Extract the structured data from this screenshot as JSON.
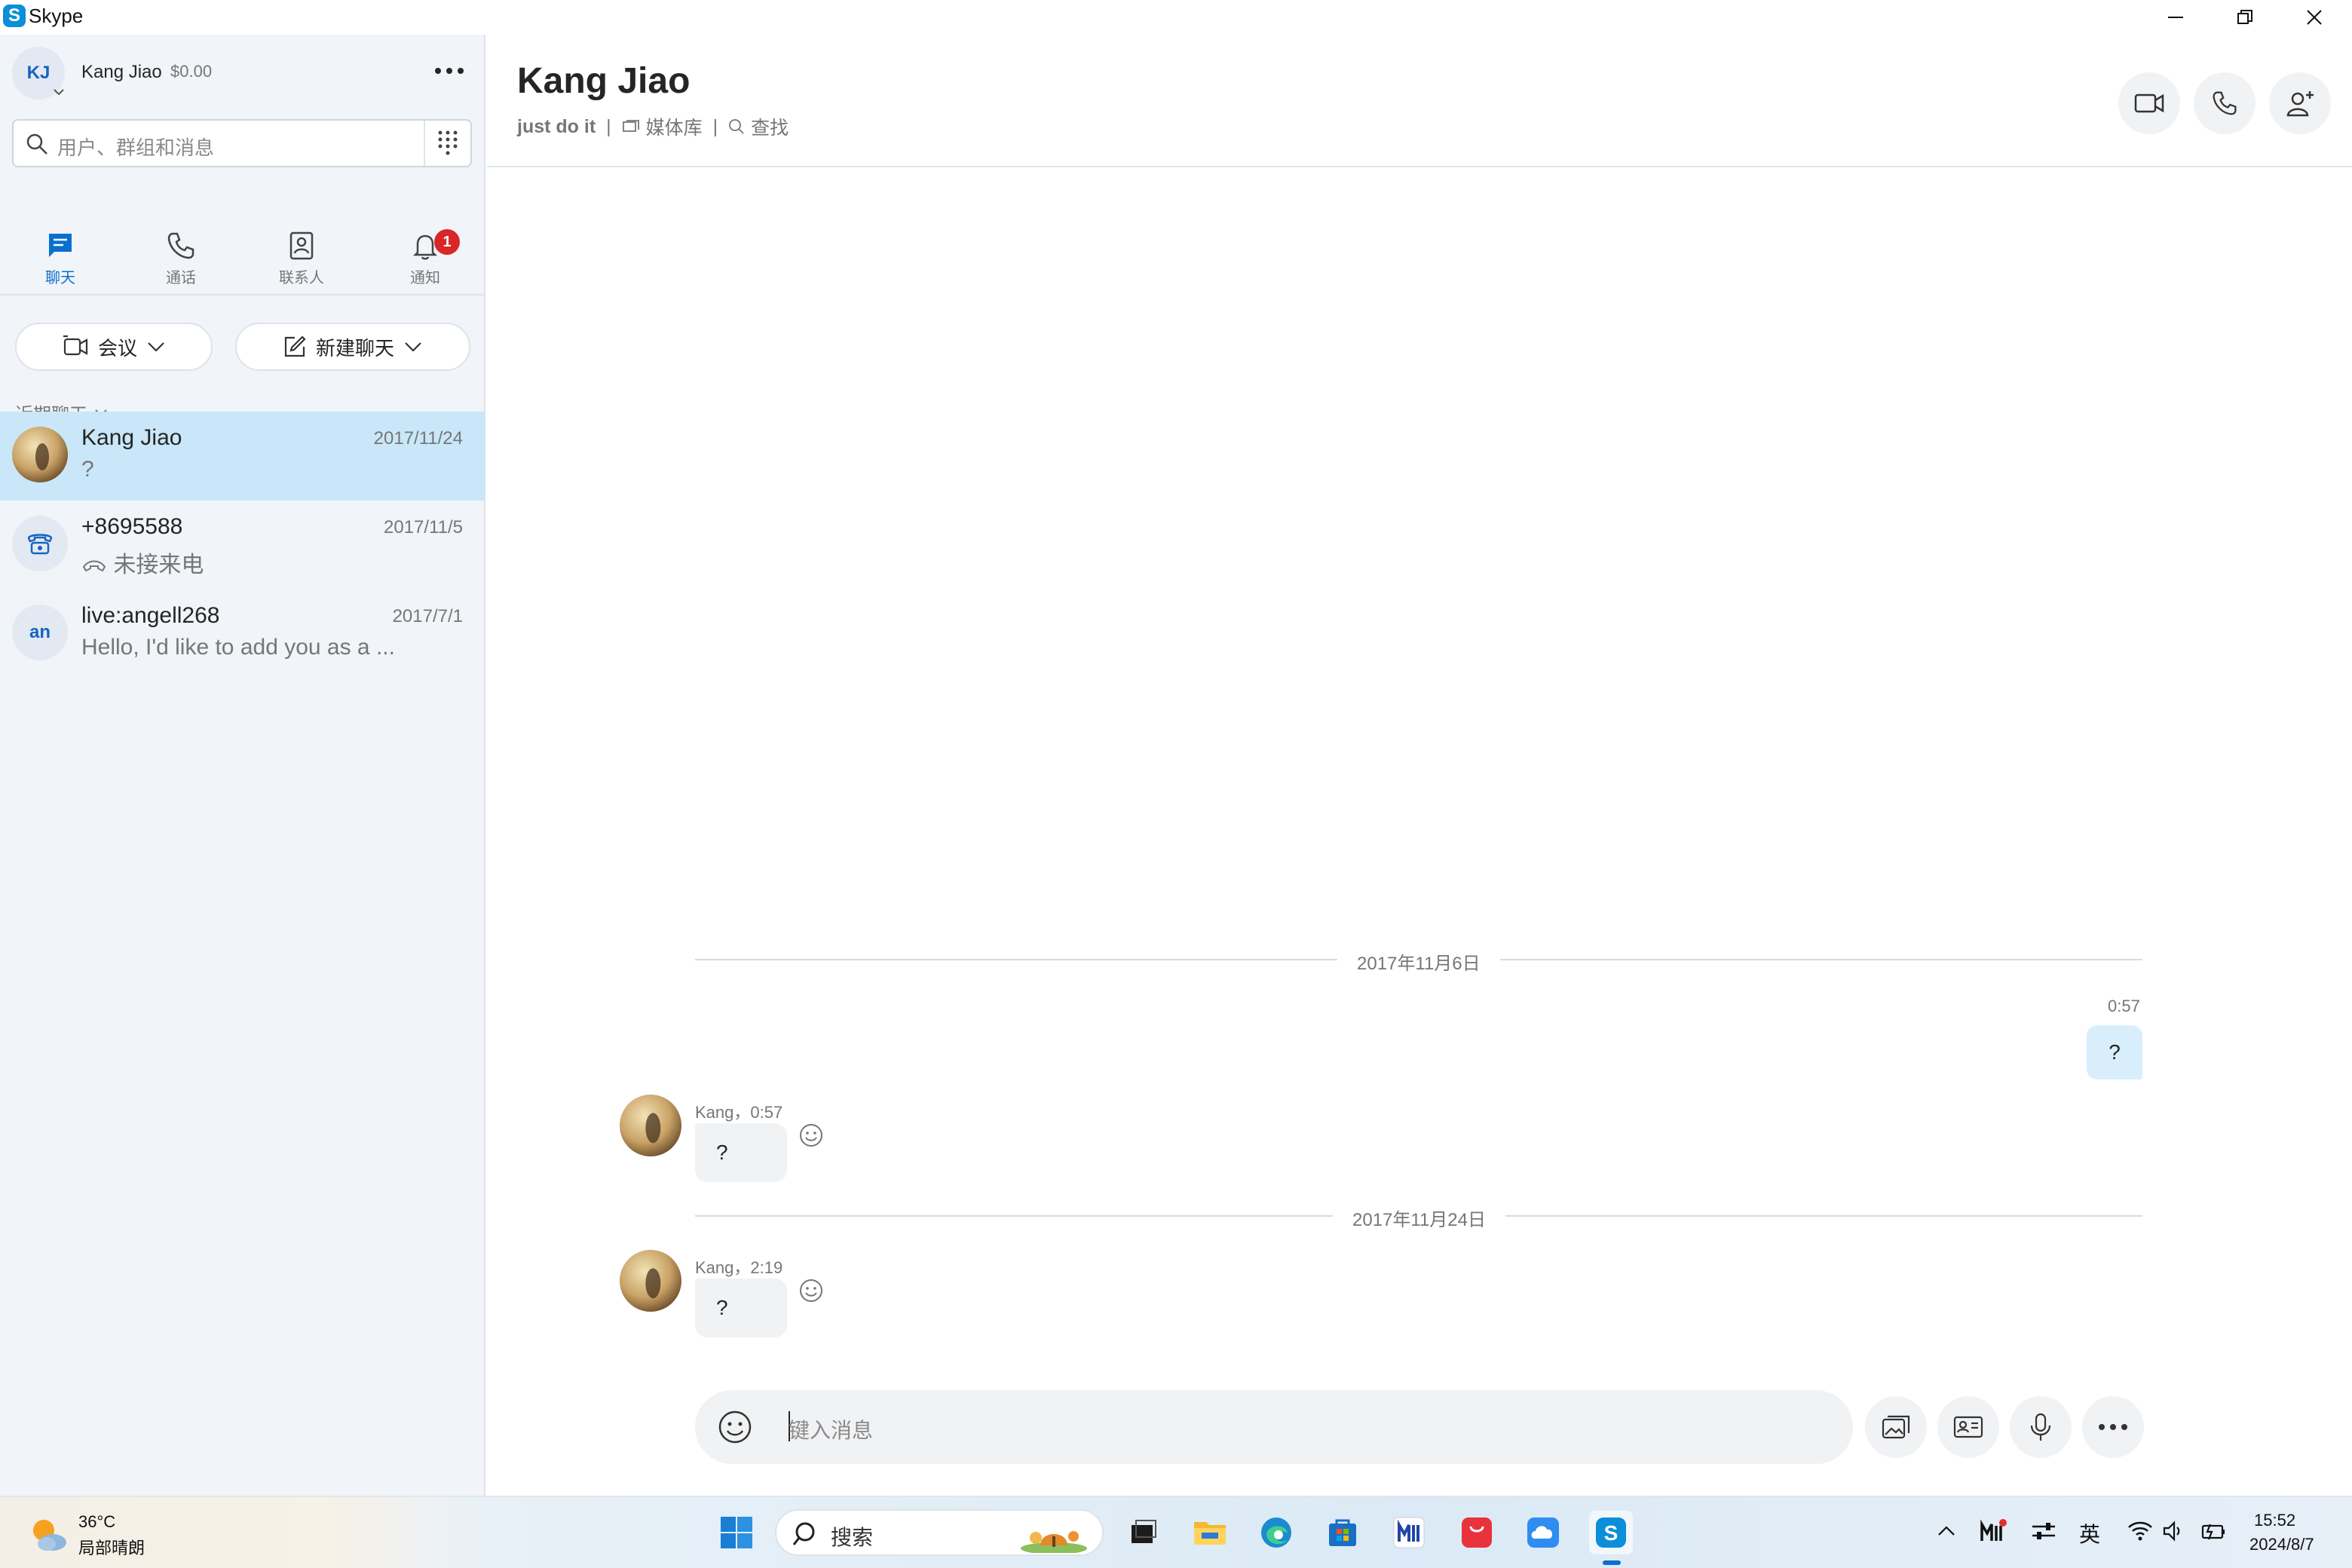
{
  "window": {
    "title": "Skype"
  },
  "profile": {
    "initials": "KJ",
    "name": "Kang Jiao",
    "credit": "$0.00"
  },
  "search": {
    "placeholder": "用户、群组和消息"
  },
  "nav": {
    "tabs": [
      {
        "label": "聊天",
        "icon": "chat-icon",
        "active": true
      },
      {
        "label": "通话",
        "icon": "phone-icon",
        "active": false
      },
      {
        "label": "联系人",
        "icon": "contacts-icon",
        "active": false
      },
      {
        "label": "通知",
        "icon": "bell-icon",
        "active": false,
        "badge": "1"
      }
    ]
  },
  "actions": {
    "meeting_label": "会议",
    "new_chat_label": "新建聊天"
  },
  "recent_label": "近期聊天",
  "chats": [
    {
      "name": "Kang Jiao",
      "date": "2017/11/24",
      "preview": "?"
    },
    {
      "name": "+8695588",
      "date": "2017/11/5",
      "preview": "未接来电"
    },
    {
      "name": "live:angell268",
      "date": "2017/7/1",
      "preview": "Hello, I'd like to add you as a ...",
      "initials": "an"
    }
  ],
  "conversation": {
    "name": "Kang Jiao",
    "mood": "just do it",
    "gallery_label": "媒体库",
    "find_label": "查找",
    "separator": "|",
    "date1": "2017年11月6日",
    "out_time": "0:57",
    "out_text": "?",
    "msg1_meta": "Kang，0:57",
    "msg1_text": "?",
    "date2": "2017年11月24日",
    "msg2_meta": "Kang，2:19",
    "msg2_text": "?"
  },
  "composer": {
    "placeholder": "键入消息"
  },
  "taskbar": {
    "temp": "36°C",
    "weather": "局部晴朗",
    "search": "搜索",
    "ime": "英",
    "time": "15:52",
    "date": "2024/8/7"
  },
  "colors": {
    "accent": "#0a70d0",
    "selected": "#c9e7f8",
    "badge": "#d92626",
    "sidebar": "#f1f4f8"
  }
}
